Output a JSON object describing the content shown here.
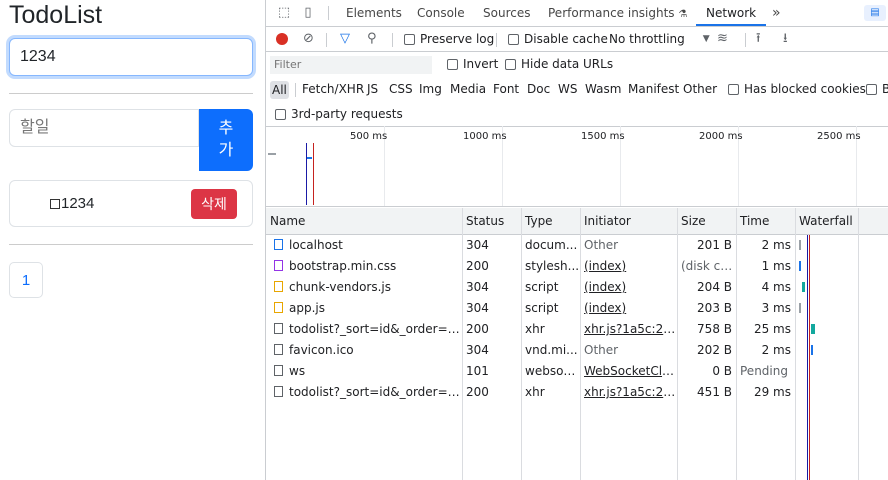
{
  "app": {
    "title": "TodoList",
    "main_input_value": "1234",
    "todo_placeholder": "할일",
    "add_label": "추가",
    "todo_item_text": "1234",
    "delete_label": "삭제",
    "page_number": "1"
  },
  "devtools": {
    "tabs": [
      "Elements",
      "Console",
      "Sources",
      "Performance insights",
      "Network"
    ],
    "active_tab": "Network",
    "more_tabs": "»",
    "toolbar": {
      "preserve_log": "Preserve log",
      "disable_cache": "Disable cache",
      "throttling": "No throttling"
    },
    "filter_placeholder": "Filter",
    "invert": "Invert",
    "hide_data_urls": "Hide data URLs",
    "types": [
      "All",
      "Fetch/XHR",
      "JS",
      "CSS",
      "Img",
      "Media",
      "Font",
      "Doc",
      "WS",
      "Wasm",
      "Manifest",
      "Other"
    ],
    "has_blocked_cookies": "Has blocked cookies",
    "third_party": "3rd-party requests",
    "overview_ticks": [
      "500 ms",
      "1000 ms",
      "1500 ms",
      "2000 ms",
      "2500 ms"
    ],
    "columns": [
      "Name",
      "Status",
      "Type",
      "Initiator",
      "Size",
      "Time",
      "Waterfall"
    ],
    "rows": [
      {
        "name": "localhost",
        "icon": "document-icon",
        "status": "304",
        "type": "docum...",
        "initiator": "Other",
        "initiator_link": false,
        "size": "201 B",
        "time": "2 ms"
      },
      {
        "name": "bootstrap.min.css",
        "icon": "stylesheet-icon",
        "status": "200",
        "type": "stylesh...",
        "initiator": "(index)",
        "initiator_link": true,
        "size": "(disk ca...",
        "time": "1 ms"
      },
      {
        "name": "chunk-vendors.js",
        "icon": "script-icon",
        "status": "304",
        "type": "script",
        "initiator": "(index)",
        "initiator_link": true,
        "size": "204 B",
        "time": "4 ms"
      },
      {
        "name": "app.js",
        "icon": "script-icon",
        "status": "304",
        "type": "script",
        "initiator": "(index)",
        "initiator_link": true,
        "size": "203 B",
        "time": "3 ms"
      },
      {
        "name": "todolist?_sort=id&_order=de...",
        "icon": "file-icon",
        "status": "200",
        "type": "xhr",
        "initiator": "xhr.js?1a5c:220",
        "initiator_link": true,
        "size": "758 B",
        "time": "25 ms"
      },
      {
        "name": "favicon.ico",
        "icon": "file-icon",
        "status": "304",
        "type": "vnd.mi...",
        "initiator": "Other",
        "initiator_link": false,
        "size": "202 B",
        "time": "2 ms"
      },
      {
        "name": "ws",
        "icon": "file-icon",
        "status": "101",
        "type": "websoc...",
        "initiator": "WebSocketClie...",
        "initiator_link": true,
        "size": "0 B",
        "time": "Pending"
      },
      {
        "name": "todolist?_sort=id&_order=de...",
        "icon": "file-icon",
        "status": "200",
        "type": "xhr",
        "initiator": "xhr.js?1a5c:220",
        "initiator_link": true,
        "size": "451 B",
        "time": "29 ms"
      }
    ]
  }
}
